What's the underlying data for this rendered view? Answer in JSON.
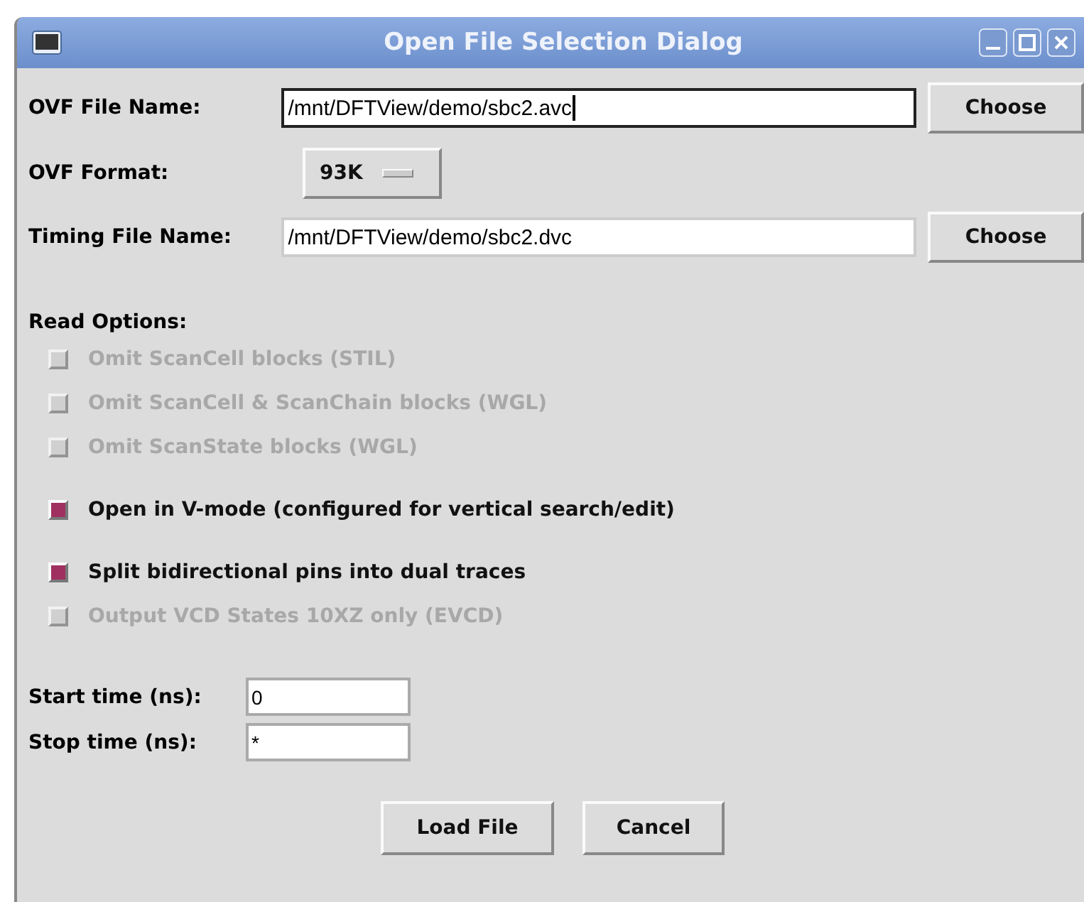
{
  "window": {
    "title": "Open File Selection Dialog"
  },
  "ovf_file": {
    "label": "OVF File Name:",
    "value": "/mnt/DFTView/demo/sbc2.avc",
    "focused": true,
    "button": "Choose"
  },
  "ovf_format": {
    "label": "OVF Format:",
    "value": "93K"
  },
  "timing_file": {
    "label": "Timing File Name:",
    "value": "/mnt/DFTView/demo/sbc2.dvc",
    "focused": false,
    "button": "Choose"
  },
  "read_options": {
    "label": "Read Options:",
    "groups": [
      [
        {
          "label": "Omit ScanCell blocks (STIL)",
          "checked": false,
          "disabled": true
        },
        {
          "label": "Omit ScanCell & ScanChain blocks (WGL)",
          "checked": false,
          "disabled": true
        },
        {
          "label": "Omit ScanState blocks (WGL)",
          "checked": false,
          "disabled": true
        }
      ],
      [
        {
          "label": "Open in V-mode (configured for vertical search/edit)",
          "checked": true,
          "disabled": false
        }
      ],
      [
        {
          "label": "Split bidirectional pins into dual traces",
          "checked": true,
          "disabled": false
        },
        {
          "label": "Output VCD States 10XZ only (EVCD)",
          "checked": false,
          "disabled": true
        }
      ]
    ]
  },
  "times": [
    {
      "label": "Start time (ns):",
      "value": "0"
    },
    {
      "label": "Stop time (ns):",
      "value": "*"
    }
  ],
  "buttons": [
    "Load File",
    "Cancel"
  ]
}
